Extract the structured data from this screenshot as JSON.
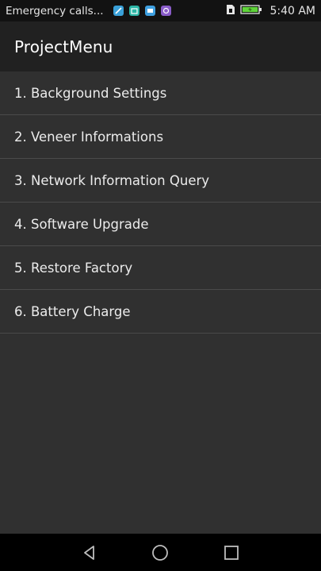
{
  "status_bar": {
    "carrier_text": "Emergency calls...",
    "notification_icons": [
      {
        "name": "edit-note-icon",
        "color": "#3aa0d8"
      },
      {
        "name": "calendar-icon",
        "color": "#2bb5a5"
      },
      {
        "name": "mail-icon",
        "color": "#3fa0e0"
      },
      {
        "name": "game-icon",
        "color": "#8a5cc9"
      }
    ],
    "time": "5:40 AM",
    "battery_color": "#5fd43a"
  },
  "action_bar": {
    "title": "ProjectMenu"
  },
  "menu": {
    "items": [
      {
        "label": "1. Background Settings"
      },
      {
        "label": "2. Veneer Informations"
      },
      {
        "label": "3. Network Information Query"
      },
      {
        "label": "4. Software Upgrade"
      },
      {
        "label": "5. Restore Factory"
      },
      {
        "label": "6. Battery Charge"
      }
    ]
  },
  "nav_bar": {
    "buttons": [
      "back-icon",
      "home-icon",
      "recents-icon"
    ]
  }
}
